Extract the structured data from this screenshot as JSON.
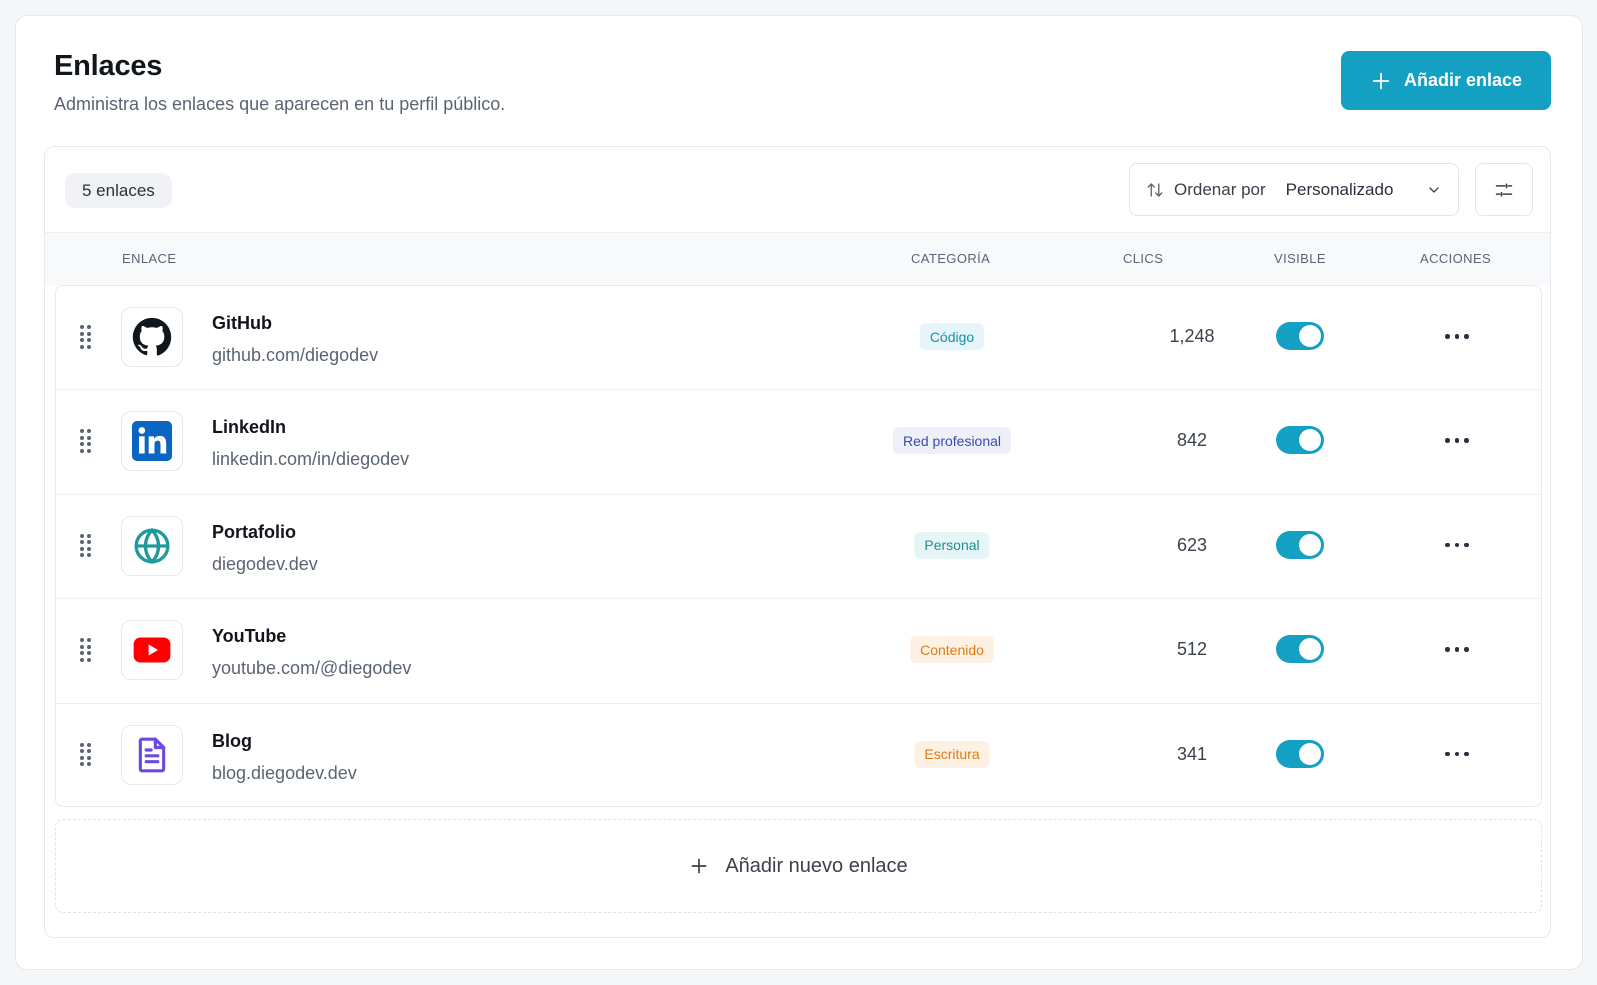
{
  "header": {
    "title": "Enlaces",
    "subtitle": "Administra los enlaces que aparecen en tu perfil público.",
    "add_button_label": "Añadir enlace"
  },
  "toolbar": {
    "count_label": "5 enlaces",
    "sort_label": "Ordenar por",
    "sort_value": "Personalizado",
    "filter_icon": "sliders-icon"
  },
  "table": {
    "columns": [
      "ENLACE",
      "CATEGORÍA",
      "CLICS",
      "VISIBLE",
      "ACCIONES"
    ],
    "rows": [
      {
        "name": "GitHub",
        "url": "github.com/diegodev",
        "category": "Código",
        "clicks": "1,248",
        "visible": true,
        "icon": "github-icon",
        "badge_bg": "#e6f5f9",
        "badge_fg": "#1590b0"
      },
      {
        "name": "LinkedIn",
        "url": "linkedin.com/in/diegodev",
        "category": "Red profesional",
        "clicks": "842",
        "visible": true,
        "icon": "linkedin-icon",
        "badge_bg": "#eef0f7",
        "badge_fg": "#3b4bb0"
      },
      {
        "name": "Portafolio",
        "url": "diegodev.dev",
        "category": "Personal",
        "clicks": "623",
        "visible": true,
        "icon": "globe-icon",
        "badge_bg": "#e6f5f5",
        "badge_fg": "#1f8f8f"
      },
      {
        "name": "YouTube",
        "url": "youtube.com/@diegodev",
        "category": "Contenido",
        "clicks": "512",
        "visible": true,
        "icon": "youtube-icon",
        "badge_bg": "#fdf1e3",
        "badge_fg": "#e07b12"
      },
      {
        "name": "Blog",
        "url": "blog.diegodev.dev",
        "category": "Escritura",
        "clicks": "341",
        "visible": true,
        "icon": "document-icon",
        "badge_bg": "#fdf1e3",
        "badge_fg": "#e07b12"
      }
    ]
  },
  "footer": {
    "add_new_label": "Añadir nuevo enlace"
  },
  "colors": {
    "accent": "#14a0c2"
  }
}
